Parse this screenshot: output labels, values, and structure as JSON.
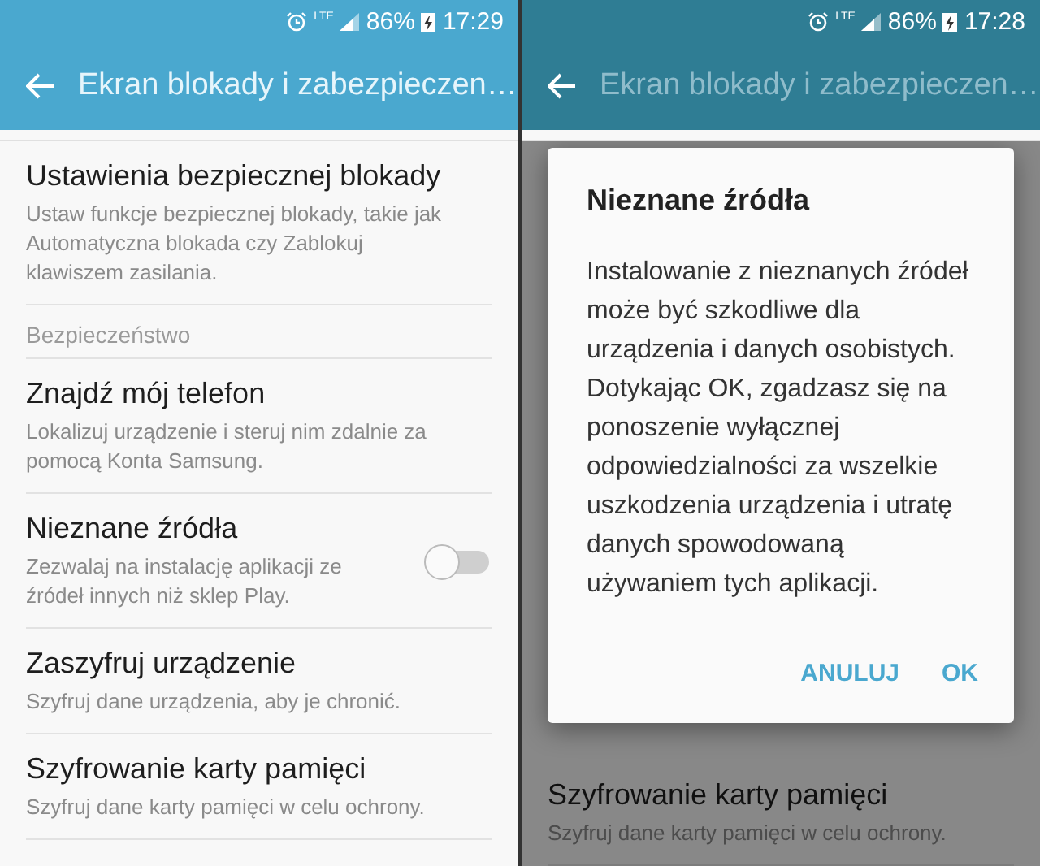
{
  "screens": [
    {
      "status_bar": {
        "network": "LTE",
        "battery": "86%",
        "time": "17:29"
      },
      "toolbar": {
        "title": "Ekran blokady i zabezpieczen…"
      },
      "list": [
        {
          "kind": "item",
          "title": "Ustawienia bezpiecznej blokady",
          "description": "Ustaw funkcje bezpiecznej blokady, takie jak Automatyczna blokada czy Zablokuj klawiszem zasilania."
        },
        {
          "kind": "header",
          "title": "Bezpieczeństwo"
        },
        {
          "kind": "item",
          "title": "Znajdź mój telefon",
          "description": "Lokalizuj urządzenie i steruj nim zdalnie za pomocą Konta Samsung."
        },
        {
          "kind": "toggle",
          "title": "Nieznane źródła",
          "description": "Zezwalaj na instalację aplikacji ze źródeł innych niż sklep Play.",
          "on": false
        },
        {
          "kind": "item",
          "title": "Zaszyfruj urządzenie",
          "description": "Szyfruj dane urządzenia, aby je chronić."
        },
        {
          "kind": "item",
          "title": "Szyfrowanie karty pamięci",
          "description": "Szyfruj dane karty pamięci w celu ochrony."
        }
      ]
    },
    {
      "status_bar": {
        "network": "LTE",
        "battery": "86%",
        "time": "17:28"
      },
      "toolbar": {
        "title": "Ekran blokady i zabezpieczen…"
      },
      "list": [
        {
          "kind": "item",
          "title": "Szyfrowanie karty pamięci",
          "description": "Szyfruj dane karty pamięci w celu ochrony."
        }
      ],
      "dialog": {
        "title": "Nieznane źródła",
        "message": "Instalowanie z nieznanych źródeł może być szkodliwe dla urządzenia i danych osobistych. Dotykając OK, zgadzasz się na ponoszenie wyłącznej odpowiedzialności za wszelkie uszkodzenia urządzenia i utratę danych spowodowaną używaniem tych aplikacji.",
        "buttons": [
          "ANULUJ",
          "OK"
        ]
      }
    }
  ]
}
